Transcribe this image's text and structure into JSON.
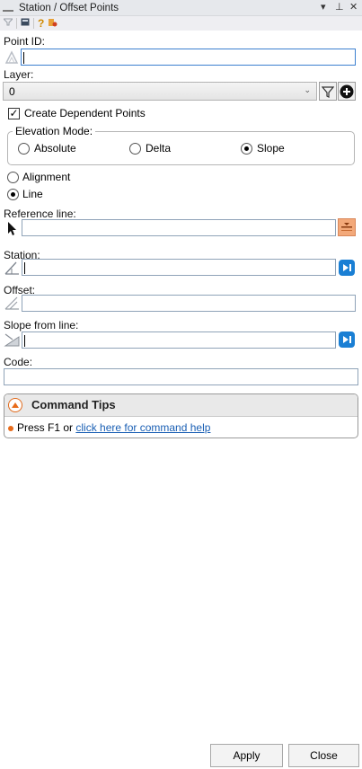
{
  "title_bar": {
    "title": "Station / Offset Points",
    "dropdown_glyph": "▾",
    "pin_glyph": "⊥",
    "close_glyph": "✕"
  },
  "toolbar": {
    "help_glyph": "?",
    "icons": [
      "filter-icon",
      "grid-icon",
      "help-icon",
      "settings-icon"
    ]
  },
  "form": {
    "point_id": {
      "label": "Point ID:",
      "value": ""
    },
    "layer": {
      "label": "Layer:",
      "value": "0"
    },
    "create_dependent": {
      "label": "Create Dependent Points",
      "checked": true
    },
    "elevation_mode": {
      "title": "Elevation Mode:",
      "options": [
        "Absolute",
        "Delta",
        "Slope"
      ],
      "selected": "Slope"
    },
    "mode": {
      "options": [
        "Alignment",
        "Line"
      ],
      "selected": "Line"
    },
    "reference_line": {
      "label": "Reference line:",
      "value": ""
    },
    "station": {
      "label": "Station:",
      "value": ""
    },
    "offset": {
      "label": "Offset:",
      "value": ""
    },
    "slope_from_line": {
      "label": "Slope from line:",
      "value": ""
    },
    "code": {
      "label": "Code:",
      "value": ""
    }
  },
  "command_tips": {
    "title": "Command Tips",
    "text_prefix": "Press F1 or ",
    "link_text": "click here for command help"
  },
  "buttons": {
    "apply": "Apply",
    "close": "Close"
  },
  "colors": {
    "accent": "#1a7fd4",
    "tip_orange": "#e86b1a",
    "focus_border": "#3c7fd0"
  }
}
